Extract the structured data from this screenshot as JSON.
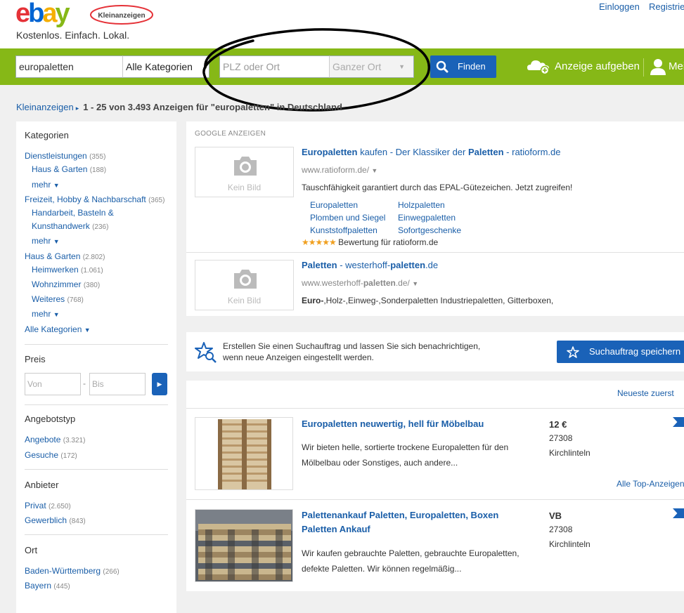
{
  "header": {
    "logo_text": "ebay",
    "logo_badge": "Kleinanzeigen",
    "tagline": "Kostenlos. Einfach. Lokal.",
    "login": "Einloggen",
    "register": "Registrieren"
  },
  "search": {
    "query": "europaletten",
    "category": "Alle Kategorien",
    "location_placeholder": "PLZ oder Ort",
    "radius": "Ganzer Ort",
    "find_label": "Finden",
    "post_ad_label": "Anzeige aufgeben",
    "my_account_label": "Mein"
  },
  "breadcrumb": {
    "root": "Kleinanzeigen",
    "summary": "1 - 25 von 3.493 Anzeigen für \"europaletten\" in Deutschland"
  },
  "sidebar": {
    "categories_title": "Kategorien",
    "cat1": {
      "label": "Dienstleistungen",
      "count": "(355)"
    },
    "cat1_sub1": {
      "label": "Haus & Garten",
      "count": "(188)"
    },
    "cat1_more": "mehr",
    "cat2": {
      "label": "Freizeit, Hobby & Nachbarschaft",
      "count": "(365)"
    },
    "cat2_sub1_line1": "Handarbeit, Basteln &",
    "cat2_sub1_line2": "Kunsthandwerk",
    "cat2_sub1_count": "(236)",
    "cat2_more": "mehr",
    "cat3": {
      "label": "Haus & Garten",
      "count": "(2.802)"
    },
    "cat3_sub1": {
      "label": "Heimwerken",
      "count": "(1.061)"
    },
    "cat3_sub2": {
      "label": "Wohnzimmer",
      "count": "(380)"
    },
    "cat3_sub3": {
      "label": "Weiteres",
      "count": "(768)"
    },
    "cat3_more": "mehr",
    "all_categories": "Alle Kategorien",
    "price_title": "Preis",
    "price_from": "Von",
    "price_dash": "-",
    "price_to": "Bis",
    "offer_type_title": "Angebotstyp",
    "offer1": {
      "label": "Angebote",
      "count": "(3.321)"
    },
    "offer2": {
      "label": "Gesuche",
      "count": "(172)"
    },
    "provider_title": "Anbieter",
    "prov1": {
      "label": "Privat",
      "count": "(2.650)"
    },
    "prov2": {
      "label": "Gewerblich",
      "count": "(843)"
    },
    "location_title": "Ort",
    "loc1": {
      "label": "Baden-Württemberg",
      "count": "(266)"
    },
    "loc2": {
      "label": "Bayern",
      "count": "(445)"
    }
  },
  "google_ads": {
    "label": "GOOGLE ANZEIGEN",
    "no_image": "Kein Bild",
    "ad1": {
      "title_a": "Europaletten",
      "title_b": " kaufen - Der Klassiker der ",
      "title_c": "Paletten",
      "title_d": " - ratioform.de",
      "url": "www.ratioform.de/",
      "desc": "Tauschfähigkeit garantiert durch das EPAL-Gütezeichen. Jetzt zugreifen!",
      "sitelinks": [
        "Europaletten",
        "Holzpaletten",
        "Plomben und Siegel",
        "Einwegpaletten",
        "Kunststoffpaletten",
        "Sofortgeschenke"
      ],
      "stars": "★★★★★",
      "rating": "Bewertung für ratioform.de"
    },
    "ad2": {
      "title_a": "Paletten",
      "title_b": " - westerhoff-",
      "title_c": "paletten",
      "title_d": ".de",
      "url_a": "www.westerhoff-",
      "url_b": "paletten",
      "url_c": ".de/",
      "desc_a": "Euro-",
      "desc_b": ",Holz-,Einweg-,Sonderpaletten Industriepaletten, Gitterboxen,"
    }
  },
  "save_search": {
    "line1": "Erstellen Sie einen Suchauftrag und lassen Sie sich benachrichtigen,",
    "line2": "wenn neue Anzeigen eingestellt werden.",
    "button": "Suchauftrag speichern"
  },
  "results": {
    "sort": "Neueste zuerst",
    "top_ads_link": "Alle Top-Anzeigen",
    "items": [
      {
        "title": "Europaletten neuwertig, hell für Möbelbau",
        "desc": "Wir bieten helle, sortierte trockene Europaletten für den Mölbelbau oder Sonstiges, auch andere...",
        "price": "12 €",
        "plz": "27308",
        "city": "Kirchlinteln"
      },
      {
        "title": "Palettenankauf Paletten, Europaletten, Boxen Paletten Ankauf",
        "desc": "Wir kaufen gebrauchte Paletten, gebrauchte Europaletten, defekte Paletten. Wir können regelmäßig...",
        "price": "VB",
        "plz": "27308",
        "city": "Kirchlinteln"
      }
    ]
  },
  "colors": {
    "green_bar": "#86b817",
    "blue_button": "#1a62b8",
    "link": "#1a5ea8",
    "logo_e": "#e53238",
    "logo_b": "#0064d2",
    "logo_a": "#f5af02",
    "logo_y": "#86b817"
  }
}
